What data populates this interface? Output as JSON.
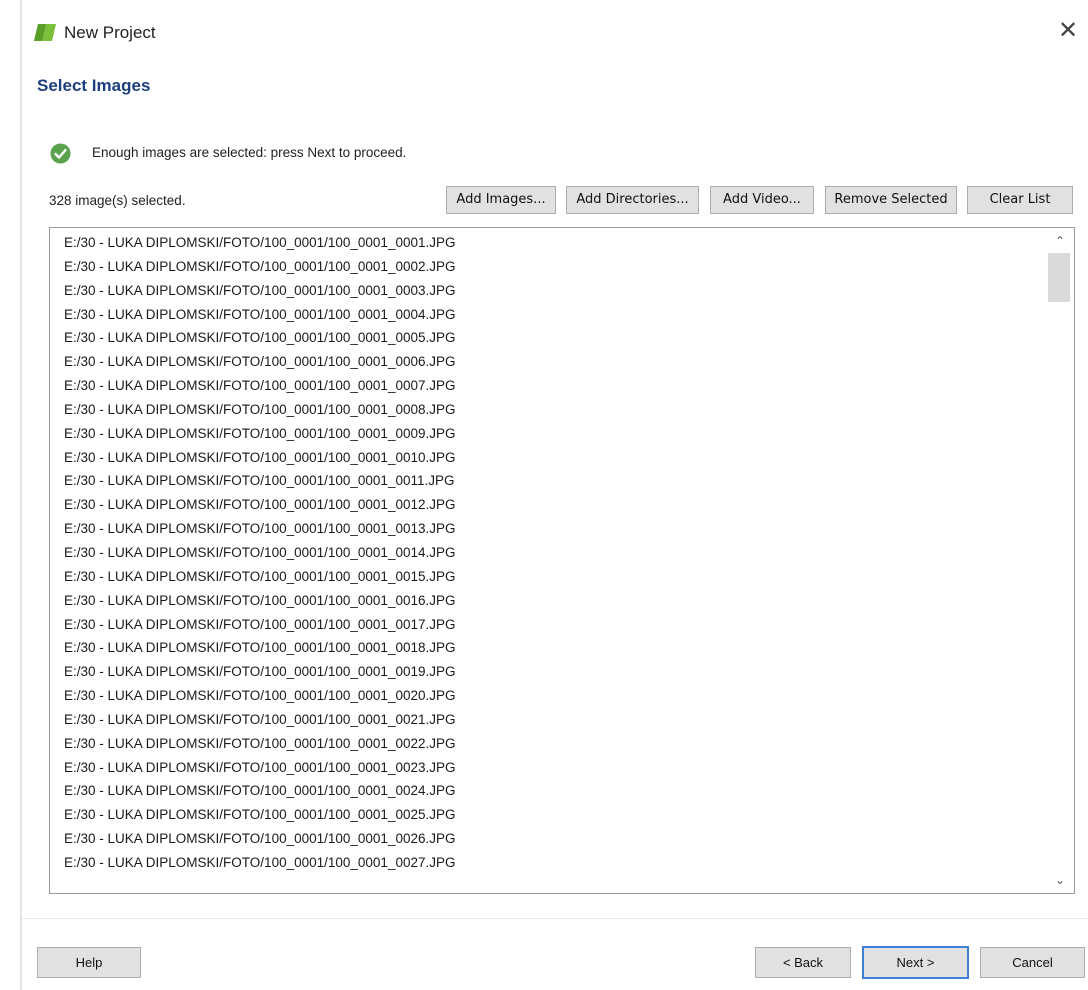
{
  "window": {
    "title": "New Project",
    "close_glyph": "✕"
  },
  "page": {
    "heading": "Select Images"
  },
  "status": {
    "icon": "check-circle-icon",
    "text": "Enough images are selected: press Next to proceed.",
    "color": "#5aa24d"
  },
  "selection": {
    "count_label": "328 image(s) selected."
  },
  "toolbar": {
    "add_images": "Add Images...",
    "add_directories": "Add Directories...",
    "add_video": "Add Video...",
    "remove_selected": "Remove Selected",
    "clear_list": "Clear List"
  },
  "file_list": {
    "items": [
      "E:/30 - LUKA DIPLOMSKI/FOTO/100_0001/100_0001_0001.JPG",
      "E:/30 - LUKA DIPLOMSKI/FOTO/100_0001/100_0001_0002.JPG",
      "E:/30 - LUKA DIPLOMSKI/FOTO/100_0001/100_0001_0003.JPG",
      "E:/30 - LUKA DIPLOMSKI/FOTO/100_0001/100_0001_0004.JPG",
      "E:/30 - LUKA DIPLOMSKI/FOTO/100_0001/100_0001_0005.JPG",
      "E:/30 - LUKA DIPLOMSKI/FOTO/100_0001/100_0001_0006.JPG",
      "E:/30 - LUKA DIPLOMSKI/FOTO/100_0001/100_0001_0007.JPG",
      "E:/30 - LUKA DIPLOMSKI/FOTO/100_0001/100_0001_0008.JPG",
      "E:/30 - LUKA DIPLOMSKI/FOTO/100_0001/100_0001_0009.JPG",
      "E:/30 - LUKA DIPLOMSKI/FOTO/100_0001/100_0001_0010.JPG",
      "E:/30 - LUKA DIPLOMSKI/FOTO/100_0001/100_0001_0011.JPG",
      "E:/30 - LUKA DIPLOMSKI/FOTO/100_0001/100_0001_0012.JPG",
      "E:/30 - LUKA DIPLOMSKI/FOTO/100_0001/100_0001_0013.JPG",
      "E:/30 - LUKA DIPLOMSKI/FOTO/100_0001/100_0001_0014.JPG",
      "E:/30 - LUKA DIPLOMSKI/FOTO/100_0001/100_0001_0015.JPG",
      "E:/30 - LUKA DIPLOMSKI/FOTO/100_0001/100_0001_0016.JPG",
      "E:/30 - LUKA DIPLOMSKI/FOTO/100_0001/100_0001_0017.JPG",
      "E:/30 - LUKA DIPLOMSKI/FOTO/100_0001/100_0001_0018.JPG",
      "E:/30 - LUKA DIPLOMSKI/FOTO/100_0001/100_0001_0019.JPG",
      "E:/30 - LUKA DIPLOMSKI/FOTO/100_0001/100_0001_0020.JPG",
      "E:/30 - LUKA DIPLOMSKI/FOTO/100_0001/100_0001_0021.JPG",
      "E:/30 - LUKA DIPLOMSKI/FOTO/100_0001/100_0001_0022.JPG",
      "E:/30 - LUKA DIPLOMSKI/FOTO/100_0001/100_0001_0023.JPG",
      "E:/30 - LUKA DIPLOMSKI/FOTO/100_0001/100_0001_0024.JPG",
      "E:/30 - LUKA DIPLOMSKI/FOTO/100_0001/100_0001_0025.JPG",
      "E:/30 - LUKA DIPLOMSKI/FOTO/100_0001/100_0001_0026.JPG",
      "E:/30 - LUKA DIPLOMSKI/FOTO/100_0001/100_0001_0027.JPG"
    ]
  },
  "footer": {
    "help": "Help",
    "back": "< Back",
    "next": "Next >",
    "cancel": "Cancel"
  },
  "colors": {
    "heading": "#1e3f80",
    "default_button_border": "#3f7fd9"
  }
}
